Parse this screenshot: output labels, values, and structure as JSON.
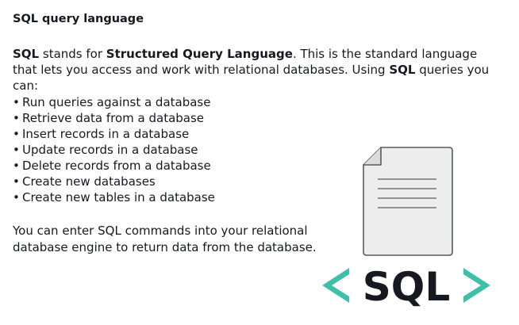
{
  "heading": "SQL query language",
  "intro": {
    "part1": "SQL",
    "part2": " stands for ",
    "part3": "Structured Query Language",
    "part4": ". This is the standard language that lets you access and work with relational databases. Using ",
    "part5": "SQL",
    "part6": " queries you can:"
  },
  "bullets": [
    "Run queries against a database",
    "Retrieve data from a database",
    "Insert records in a database",
    "Update records in a database",
    "Delete records from a database",
    "Create new databases",
    "Create new tables in a database"
  ],
  "bullet_symbol": "•",
  "closing": "You can enter SQL commands into your relational database engine to return data from the database.",
  "illustration": {
    "logo_text": "SQL",
    "bracket_color": "#3dbfa8",
    "text_color": "#16191f",
    "document_icon": "document-icon"
  }
}
